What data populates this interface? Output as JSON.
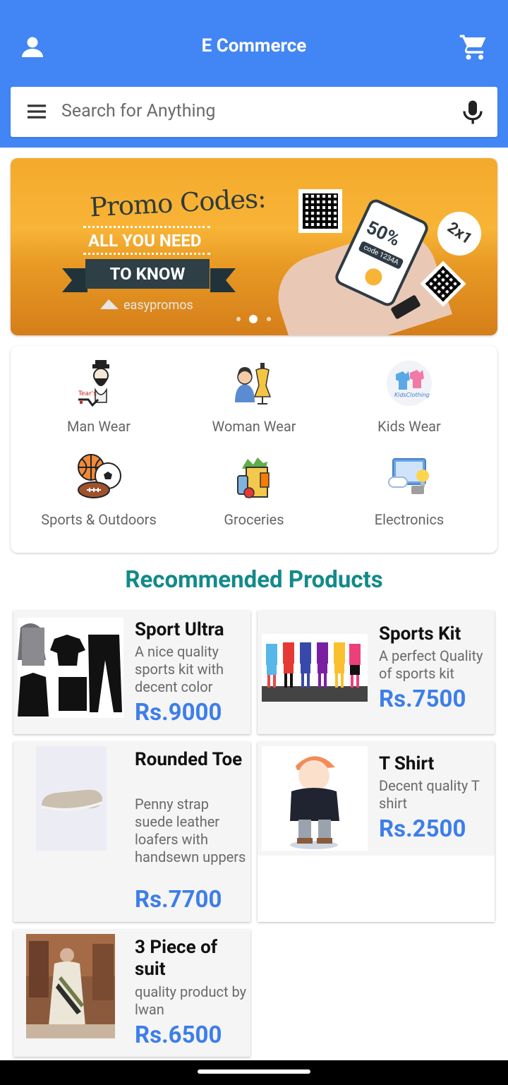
{
  "header": {
    "title": "E Commerce"
  },
  "search": {
    "placeholder": "Search for Anything"
  },
  "banner": {
    "headline": "Promo Codes:",
    "line1": "ALL YOU NEED",
    "line2": "TO KNOW",
    "brand": "easypromos",
    "discount": "50%",
    "code": "code 1234A",
    "badge": "2x1"
  },
  "categories": [
    {
      "label": "Man Wear",
      "icon": "man-wear-icon"
    },
    {
      "label": "Woman Wear",
      "icon": "woman-wear-icon"
    },
    {
      "label": "Kids Wear",
      "icon": "kids-wear-icon"
    },
    {
      "label": "Sports & Outdoors",
      "icon": "sports-icon"
    },
    {
      "label": "Groceries",
      "icon": "groceries-icon"
    },
    {
      "label": "Electronics",
      "icon": "electronics-icon"
    }
  ],
  "recommended": {
    "title": "Recommended Products",
    "products": [
      {
        "name": "Sport Ultra",
        "desc": "A nice quality sports kit with decent color",
        "price": "Rs.9000"
      },
      {
        "name": "Sports Kit",
        "desc": "A perfect Quality of sports kit",
        "price": "Rs.7500"
      },
      {
        "name": "Rounded Toe",
        "desc": "Penny strap suede leather loafers with handsewn uppers",
        "price": "Rs.7700"
      },
      {
        "name": "T Shirt",
        "desc": "Decent quality T shirt",
        "price": "Rs.2500"
      },
      {
        "name": "3 Piece of suit",
        "desc": "quality product by lwan",
        "price": "Rs.6500"
      }
    ]
  },
  "colors": {
    "appbar": "#4285f4",
    "title_teal": "#138a8a",
    "price_blue": "#3d7ee8"
  }
}
